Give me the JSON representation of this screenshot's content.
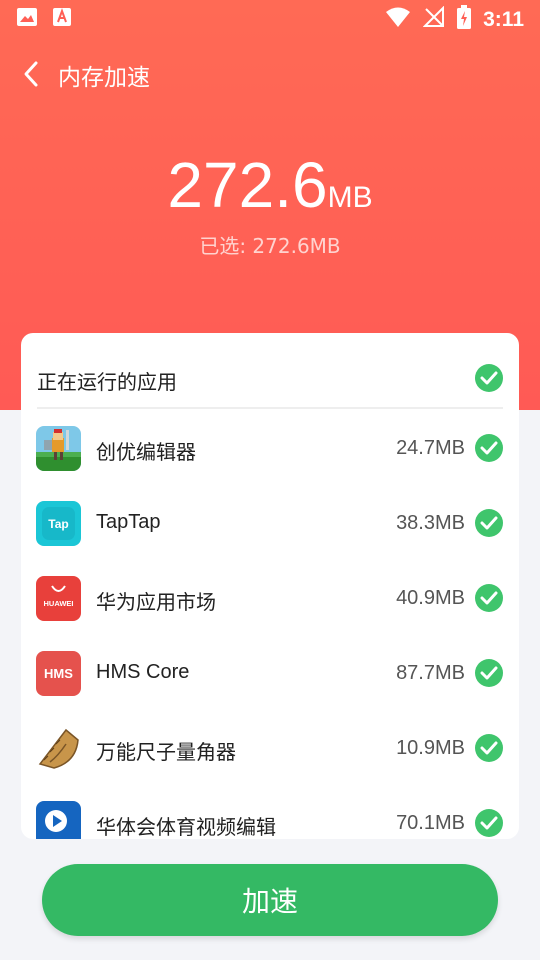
{
  "status_bar": {
    "time": "3:11",
    "left_icons": [
      "gallery-icon",
      "app-notification-icon"
    ],
    "right_icons": [
      "wifi-icon",
      "no-signal-icon",
      "battery-charging-icon"
    ]
  },
  "header": {
    "title": "内存加速",
    "back_icon": "chevron-left-icon"
  },
  "summary": {
    "amount": "272.6",
    "unit": "MB",
    "selected_text": "已选: 272.6MB"
  },
  "list": {
    "header_label": "正在运行的应用",
    "apps": [
      {
        "name": "创优编辑器",
        "size": "24.7MB",
        "icon": "pixel-knight-icon",
        "checked": true
      },
      {
        "name": "TapTap",
        "size": "38.3MB",
        "icon": "taptap-icon",
        "checked": true
      },
      {
        "name": "华为应用市场",
        "size": "40.9MB",
        "icon": "huawei-appgallery-icon",
        "checked": true
      },
      {
        "name": "HMS Core",
        "size": "87.7MB",
        "icon": "hms-core-icon",
        "checked": true
      },
      {
        "name": "万能尺子量角器",
        "size": "10.9MB",
        "icon": "protractor-icon",
        "checked": true
      },
      {
        "name": "华体会体育视频编辑",
        "size": "70.1MB",
        "icon": "video-editor-icon",
        "checked": true
      }
    ]
  },
  "actions": {
    "boost_label": "加速"
  },
  "colors": {
    "hero": "#ff5f55",
    "check": "#3fc56c",
    "button": "#34b964"
  }
}
